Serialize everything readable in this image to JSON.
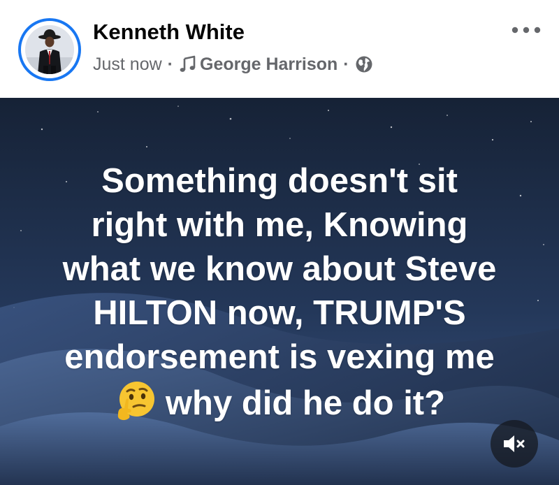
{
  "post": {
    "author": "Kenneth White",
    "timestamp": "Just now",
    "separator": "·",
    "music_label": "George Harrison",
    "audience_icon": "globe-icon",
    "music_icon": "music-note-icon",
    "more_icon": "more-options-icon",
    "text_lines": [
      "Something doesn't sit",
      "right with me, Knowing",
      "what we know about Steve",
      "HILTON now, TRUMP'S",
      "endorsement is vexing me",
      "why did he do it?"
    ],
    "emoji": "thinking-face-emoji",
    "mute_icon": "speaker-muted-icon"
  },
  "colors": {
    "accent": "#1877f2",
    "name_text": "#050505",
    "meta_text": "#65676b",
    "post_text": "#ffffff",
    "background_top": "#1a2740",
    "background_bottom": "#3d5680"
  }
}
